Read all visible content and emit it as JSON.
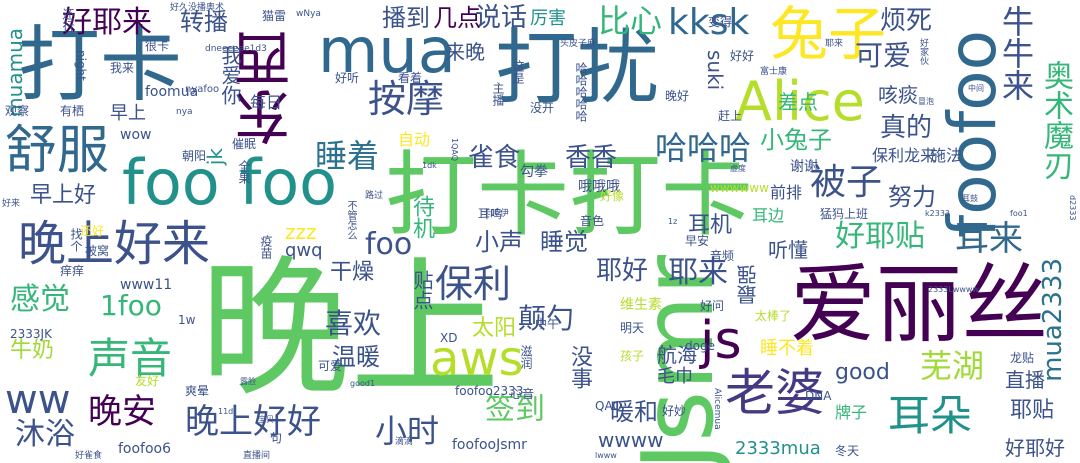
{
  "words": [
    {
      "text": "晚上",
      "color": "#5ec962"
    },
    {
      "text": "打卡打卡",
      "color": "#5ec962"
    },
    {
      "text": "打扰",
      "color": "#31688e"
    },
    {
      "text": "打卡",
      "color": "#31688e"
    },
    {
      "text": "Jsmr",
      "color": "#5ec962"
    },
    {
      "text": "爱丽丝",
      "color": "#440154"
    },
    {
      "text": "foo foo",
      "color": "#21918c"
    },
    {
      "text": "foofoo",
      "color": "#31688e"
    },
    {
      "text": "东西",
      "color": "#440154"
    },
    {
      "text": "mua",
      "color": "#31688e"
    },
    {
      "text": "兔子",
      "color": "#fde725"
    },
    {
      "text": "Alice",
      "color": "#b5de2b"
    },
    {
      "text": "舒服",
      "color": "#31688e"
    },
    {
      "text": "aws",
      "color": "#b5de2b"
    },
    {
      "text": "js",
      "color": "#440154"
    },
    {
      "text": "晚上好来",
      "color": "#3b528b"
    },
    {
      "text": "声音",
      "color": "#35b779"
    },
    {
      "text": "老婆",
      "color": "#443983"
    },
    {
      "text": "耳朵",
      "color": "#21918c"
    },
    {
      "text": "按摩",
      "color": "#3b528b"
    },
    {
      "text": "好耶来",
      "color": "#440154"
    },
    {
      "text": "转播",
      "color": "#3b528b"
    },
    {
      "text": "播到",
      "color": "#3b528b"
    },
    {
      "text": "几点",
      "color": "#440154"
    },
    {
      "text": "说话",
      "color": "#3b528b"
    },
    {
      "text": "厉害",
      "color": "#21918c"
    },
    {
      "text": "比心",
      "color": "#35b779"
    },
    {
      "text": "kksk",
      "color": "#31688e"
    },
    {
      "text": "可爱",
      "color": "#3b528b"
    },
    {
      "text": "烦死",
      "color": "#3b528b"
    },
    {
      "text": "牛牛来",
      "color": "#3b528b"
    },
    {
      "text": "奥术魔刃",
      "color": "#35b779"
    },
    {
      "text": "睡着",
      "color": "#2c728e"
    },
    {
      "text": "雀食",
      "color": "#3b528b"
    },
    {
      "text": "香香",
      "color": "#3b528b"
    },
    {
      "text": "哈哈哈",
      "color": "#31688e"
    },
    {
      "text": "被子",
      "color": "#3b528b"
    },
    {
      "text": "真的",
      "color": "#3b528b"
    },
    {
      "text": "努力",
      "color": "#3b528b"
    },
    {
      "text": "小兔子",
      "color": "#35b779"
    },
    {
      "text": "好耶贴",
      "color": "#35b779"
    },
    {
      "text": "耳来",
      "color": "#31688e"
    },
    {
      "text": "耶来",
      "color": "#3b528b"
    },
    {
      "text": "保利",
      "color": "#3b528b"
    },
    {
      "text": "喜欢",
      "color": "#3b528b"
    },
    {
      "text": "颠勺",
      "color": "#3b528b"
    },
    {
      "text": "睡觉",
      "color": "#3b528b"
    },
    {
      "text": "耶好",
      "color": "#3b528b"
    },
    {
      "text": "感觉",
      "color": "#35b779"
    },
    {
      "text": "1foo",
      "color": "#35b779"
    },
    {
      "text": "晚安",
      "color": "#440154"
    },
    {
      "text": "晚上好好",
      "color": "#3b528b"
    },
    {
      "text": "沐浴",
      "color": "#3b528b"
    },
    {
      "text": "小时",
      "color": "#3b528b"
    },
    {
      "text": "签到",
      "color": "#5ec962"
    },
    {
      "text": "暖和",
      "color": "#3b528b"
    },
    {
      "text": "芜湖",
      "color": "#a0da39"
    },
    {
      "text": "耳机",
      "color": "#3b528b"
    },
    {
      "text": "mua2333",
      "color": "#2c728e"
    },
    {
      "text": "早上好",
      "color": "#3b528b"
    },
    {
      "text": "muamua",
      "color": "#21918c"
    },
    {
      "text": "牛奶",
      "color": "#a0da39"
    },
    {
      "text": "foo",
      "color": "#3b528b"
    },
    {
      "text": "小声",
      "color": "#3b528b"
    },
    {
      "text": "温暖",
      "color": "#3b528b"
    },
    {
      "text": "太阳",
      "color": "#b5de2b"
    },
    {
      "text": "good",
      "color": "#3b528b"
    },
    {
      "text": "ww",
      "color": "#3b528b"
    },
    {
      "text": "jk",
      "color": "#21918c"
    },
    {
      "text": "zzz",
      "color": "#fde725"
    },
    {
      "text": "qwq",
      "color": "#3b528b"
    },
    {
      "text": "干燥",
      "color": "#3b528b"
    },
    {
      "text": "待机",
      "color": "#35b779"
    },
    {
      "text": "前排",
      "color": "#3b528b"
    },
    {
      "text": "听懂",
      "color": "#3b528b"
    },
    {
      "text": "耳边",
      "color": "#35b779"
    },
    {
      "text": "直播",
      "color": "#3b528b"
    },
    {
      "text": "suki",
      "color": "#3b528b"
    },
    {
      "text": "差点",
      "color": "#35b779"
    },
    {
      "text": "咳痰",
      "color": "#3b528b"
    },
    {
      "text": "保利龙来",
      "color": "#3b528b"
    },
    {
      "text": "施法",
      "color": "#3b528b"
    },
    {
      "text": "谢谢",
      "color": "#3b528b"
    },
    {
      "text": "最强",
      "color": "#3b528b"
    },
    {
      "text": "贴点",
      "color": "#3b528b"
    },
    {
      "text": "航海",
      "color": "#3b528b"
    },
    {
      "text": "没事",
      "color": "#3b528b"
    },
    {
      "text": "毛巾",
      "color": "#3b528b"
    },
    {
      "text": "维生素",
      "color": "#b5de2b"
    },
    {
      "text": "睡不着",
      "color": "#fde725"
    },
    {
      "text": "耶贴",
      "color": "#3b528b"
    },
    {
      "text": "好耶好",
      "color": "#3b528b"
    },
    {
      "text": "2333mua",
      "color": "#21918c"
    },
    {
      "text": "wwww",
      "color": "#3b528b"
    },
    {
      "text": "牌子",
      "color": "#35b779"
    },
    {
      "text": "自动",
      "color": "#fde725"
    },
    {
      "text": "来晚",
      "color": "#3b528b"
    },
    {
      "text": "我爱你",
      "color": "#3b528b"
    },
    {
      "text": "早上",
      "color": "#3b528b"
    },
    {
      "text": "每日",
      "color": "#3b528b"
    },
    {
      "text": "wow",
      "color": "#3b528b"
    },
    {
      "text": "foomua",
      "color": "#3b528b"
    },
    {
      "text": "www11",
      "color": "#3b528b"
    },
    {
      "text": "2333JK",
      "color": "#3b528b"
    },
    {
      "text": "foofoo2333",
      "color": "#3b528b"
    },
    {
      "text": "foofooJsmr",
      "color": "#3b528b"
    },
    {
      "text": "foofoo6",
      "color": "#3b528b"
    },
    {
      "text": "QAQ",
      "color": "#3b528b"
    },
    {
      "text": "DNA",
      "color": "#3b528b"
    },
    {
      "text": "XD",
      "color": "#3b528b"
    },
    {
      "text": "doge",
      "color": "#3b528b"
    },
    {
      "text": "1w",
      "color": "#3b528b"
    },
    {
      "text": "wwwwww",
      "color": "#b5de2b"
    },
    {
      "text": "冬天",
      "color": "#3b528b"
    },
    {
      "text": "好妙",
      "color": "#3b528b"
    },
    {
      "text": "心音",
      "color": "#3b528b"
    },
    {
      "text": "明天",
      "color": "#3b528b"
    },
    {
      "text": "孩子",
      "color": "#b5de2b"
    },
    {
      "text": "太棒了",
      "color": "#b5de2b"
    },
    {
      "text": "中午",
      "color": "#3b528b"
    },
    {
      "text": "滋润",
      "color": "#3b528b"
    },
    {
      "text": "友好",
      "color": "#b5de2b"
    },
    {
      "text": "爽晕",
      "color": "#3b528b"
    },
    {
      "text": "可爱",
      "color": "#3b528b"
    },
    {
      "text": "勾拳",
      "color": "#3b528b"
    },
    {
      "text": "哦哦哦",
      "color": "#3b528b"
    },
    {
      "text": "音色",
      "color": "#3b528b"
    },
    {
      "text": "早安",
      "color": "#3b528b"
    },
    {
      "text": "音频",
      "color": "#3b528b"
    },
    {
      "text": "还好",
      "color": "#fde725"
    },
    {
      "text": "被窝",
      "color": "#3b528b"
    },
    {
      "text": "痒痒",
      "color": "#3b528b"
    },
    {
      "text": "耳鸣",
      "color": "#3b528b"
    },
    {
      "text": "好像",
      "color": "#b5de2b"
    },
    {
      "text": "主播",
      "color": "#3b528b"
    },
    {
      "text": "这是",
      "color": "#3b528b"
    },
    {
      "text": "没开",
      "color": "#3b528b"
    },
    {
      "text": "哈哈哈哈哈",
      "color": "#3b528b"
    },
    {
      "text": "晚好",
      "color": "#3b528b"
    },
    {
      "text": "赶上",
      "color": "#3b528b"
    },
    {
      "text": "看着",
      "color": "#3b528b"
    },
    {
      "text": "好听",
      "color": "#3b528b"
    },
    {
      "text": "有栖",
      "color": "#3b528b"
    },
    {
      "text": "观察",
      "color": "#3b528b"
    },
    {
      "text": "我来",
      "color": "#3b528b"
    },
    {
      "text": "很卡",
      "color": "#3b528b"
    },
    {
      "text": "猫雷",
      "color": "#3b528b"
    },
    {
      "text": "变得",
      "color": "#3b528b"
    },
    {
      "text": "好好",
      "color": "#3b528b"
    },
    {
      "text": "night",
      "color": "#3b528b"
    },
    {
      "text": "催眠",
      "color": "#3b528b"
    },
    {
      "text": "朝阳",
      "color": "#3b528b"
    },
    {
      "text": "全果",
      "color": "#3b528b"
    },
    {
      "text": "疫苗",
      "color": "#3b528b"
    },
    {
      "text": "找个",
      "color": "#3b528b"
    },
    {
      "text": "猛犸上班",
      "color": "#3b528b"
    },
    {
      "text": "龙贴",
      "color": "#3b528b"
    },
    {
      "text": "句",
      "color": "#3b528b"
    },
    {
      "text": "好问",
      "color": "#3b528b"
    },
    {
      "text": "还行",
      "color": "#3b528b"
    },
    {
      "text": "nyafoo",
      "color": "#3b528b"
    },
    {
      "text": "dneeeeee1d3",
      "color": "#3b528b"
    },
    {
      "text": "Alicemua",
      "color": "#3b528b"
    },
    {
      "text": "好久没播奥术",
      "color": "#3b528b"
    },
    {
      "text": "头皮子麻",
      "color": "#3b528b"
    },
    {
      "text": "耶来",
      "color": "#3b528b"
    },
    {
      "text": "富士康",
      "color": "#3b528b"
    },
    {
      "text": "好家伙",
      "color": "#3b528b"
    },
    {
      "text": "不管怎么",
      "color": "#3b528b"
    },
    {
      "text": "路过",
      "color": "#3b528b"
    },
    {
      "text": "卡哇伊",
      "color": "#3b528b"
    },
    {
      "text": "滴滴",
      "color": "#3b528b"
    },
    {
      "text": "直播间",
      "color": "#3b528b"
    },
    {
      "text": "好雀食",
      "color": "#3b528b"
    },
    {
      "text": "好来",
      "color": "#3b528b"
    },
    {
      "text": "wNya",
      "color": "#3b528b"
    },
    {
      "text": "nya",
      "color": "#3b528b"
    },
    {
      "text": "1dk",
      "color": "#3b528b"
    },
    {
      "text": "1QAQ",
      "color": "#3b528b"
    },
    {
      "text": "1z",
      "color": "#3b528b"
    },
    {
      "text": "k2333",
      "color": "#3b528b"
    },
    {
      "text": "foo1",
      "color": "#3b528b"
    },
    {
      "text": "d2333",
      "color": "#3b528b"
    },
    {
      "text": "2333Lwwww",
      "color": "#3b528b"
    },
    {
      "text": "lwww",
      "color": "#3b528b"
    },
    {
      "text": "11d",
      "color": "#3b528b"
    },
    {
      "text": "good1",
      "color": "#3b528b"
    },
    {
      "text": "虚度",
      "color": "#3b528b"
    },
    {
      "text": "耳鼓",
      "color": "#3b528b"
    },
    {
      "text": "露脸",
      "color": "#3b528b"
    },
    {
      "text": "宝贝",
      "color": "#3b528b"
    },
    {
      "text": "中间",
      "color": "#3b528b"
    },
    {
      "text": "冒泡",
      "color": "#3b528b"
    }
  ]
}
